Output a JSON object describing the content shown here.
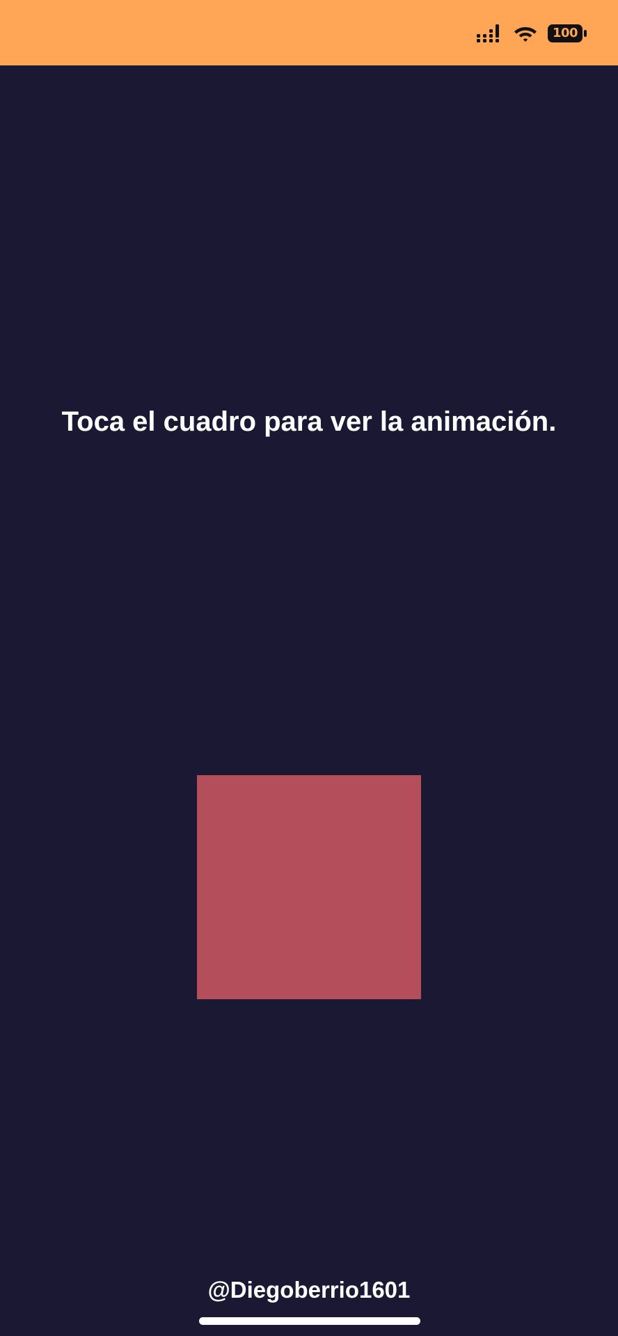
{
  "status_bar": {
    "background_color": "#ffa556",
    "signal_icon": "cellular-signal-icon",
    "wifi_icon": "wifi-icon",
    "battery_icon": "battery-icon",
    "battery_level": "100"
  },
  "main": {
    "background_color": "#1b1834",
    "instruction": "Toca el cuadro para ver la animación.",
    "square_color": "#b34e5a"
  },
  "footer": {
    "handle": "@Diegoberrio1601"
  }
}
